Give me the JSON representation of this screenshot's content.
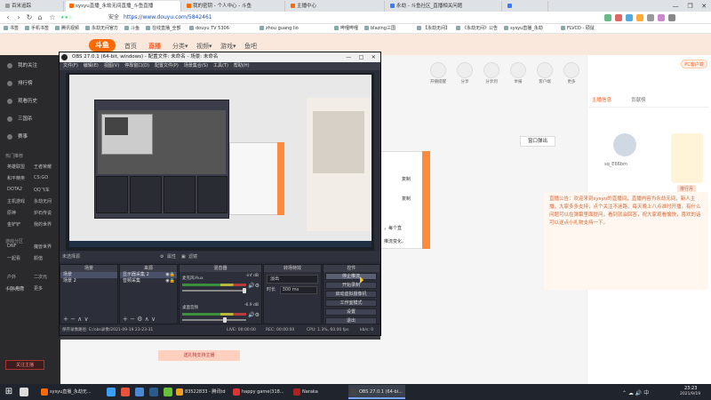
{
  "browser": {
    "tabs": [
      {
        "label": "百米追踪",
        "fav": "#9b9b9b"
      },
      {
        "label": "sysyu直播_永劫无间直播_斗鱼直播",
        "fav": "#ff6a00",
        "active": true
      },
      {
        "label": "我的密钥 - 个人中心 - 斗鱼",
        "fav": "#ff6a00"
      },
      {
        "label": "主播中心",
        "fav": "#ff6a00"
      },
      {
        "label": "永劫 - 斗鱼社区_直播相关问题",
        "fav": "#3b7cff"
      },
      {
        "label": "",
        "fav": "#3b7cff"
      }
    ],
    "window_buttons": [
      "—",
      "❐",
      "✕"
    ],
    "url_secure": "安全",
    "url": "https://www.douyu.com/5842461",
    "bookmarks": [
      "书签",
      "手机书签",
      "腾讯视频",
      "永劫无间官方",
      "斗鱼",
      "在线直播_全部",
      "douyu TV 5306",
      "zhou guang lio",
      "哔哩哔哩",
      "blazing三国",
      "【永劫无间】",
      "《永劫无间》公告",
      "sysyu直播_永劫",
      "FLVCD - 硕鼠"
    ]
  },
  "douyu": {
    "logo": "斗鱼",
    "nav": [
      {
        "label": "首页",
        "on": false
      },
      {
        "label": "直播",
        "on": true
      },
      {
        "label": "分类▾",
        "on": false
      },
      {
        "label": "视频▾",
        "on": false
      },
      {
        "label": "游戏▾",
        "on": false
      },
      {
        "label": "鱼吧",
        "on": false
      }
    ],
    "sidebar": {
      "items": [
        "我的关注",
        "排行榜",
        "观看历史",
        "三国杀",
        "赛事"
      ],
      "sections": [
        "热门推荐",
        "游戏分区",
        "手游休闲"
      ],
      "grid": [
        "英雄联盟",
        "王者荣耀",
        "和平精英",
        "CS:GO",
        "DOTA2",
        "QQ飞车",
        "主机游戏",
        "永劫无间",
        "原神",
        "炉石传说",
        "金铲铲",
        "我的世界",
        "DNF",
        "魔兽世界",
        "一起看",
        "颜值",
        "户外",
        "二次元",
        "LOL电竞",
        "更多"
      ],
      "follow_btn": "关注主播"
    },
    "toolbar": [
      "开播提醒",
      "分享",
      "分享到",
      "举报",
      "客户端",
      "更多"
    ],
    "pc_button": "PC客户端",
    "right_tabs": [
      "主播信息",
      "贡献榜"
    ],
    "popout": "窗口弹出",
    "white_card": [
      "复制",
      "复制",
      "，每个直",
      "推流变化。"
    ],
    "anchor_name": "sq_E66bm",
    "rank_label": "排行月",
    "notice": "直播公告：欢迎来到sysyu的直播间，直播内容为永劫无间，新人主播，大家多多支持，点个关注不迷路，每天晚上八点准时开播，有什么问题可以在弹幕里面提问，看到就会回答，祝大家观看愉快，喜欢的话可以送点小礼物支持一下。",
    "gift_bar": "送礼物支持主播"
  },
  "obs": {
    "title": "OBS 27.0.1 (64-bit, windows) - 配置文件: 未命名 - 场景: 未命名",
    "menu": [
      "文件(F)",
      "编辑(E)",
      "视图(V)",
      "停靠窗口(D)",
      "配置文件(P)",
      "场景集合(S)",
      "工具(T)",
      "帮助(H)"
    ],
    "window_buttons": [
      "—",
      "□",
      "✕"
    ],
    "ctrl_bar": {
      "left": "未选择源",
      "props": "属性",
      "filters": "滤镜"
    },
    "docks": {
      "scenes": {
        "title": "场景",
        "items": [
          "场景",
          "场景 2"
        ]
      },
      "sources": {
        "title": "来源",
        "items": [
          "显示器采集 2",
          "音频采集"
        ]
      },
      "mixer": {
        "title": "混音器",
        "channels": [
          {
            "name": "麦克风/Aux",
            "db": "-inf dB"
          },
          {
            "name": "桌面音频",
            "db": "-6.9 dB"
          }
        ]
      },
      "transitions": {
        "title": "转场特效",
        "type": "淡出",
        "duration_label": "时长",
        "duration": "300 ms"
      },
      "controls": {
        "title": "控件",
        "buttons": [
          "停止推流",
          "开始录制",
          "启动虚拟摄像机",
          "工作室模式",
          "设置",
          "退出"
        ]
      }
    },
    "status": {
      "save": "保存录像路径: E:/obs录像/2021-09-19 23-23-31",
      "live": "LIVE: 00:00:00",
      "rec": "REC: 00:00:00",
      "cpu": "CPU: 1.3%, 60.00 fps",
      "kb": "kb/s: 0"
    },
    "foot_icons": "+ − ∧ ∨",
    "foot_icons_src": "+ − ⚙ ∧ ∨"
  },
  "taskbar": {
    "apps": [
      {
        "label": "sysyu直播_永劫无...",
        "color": "#ff6a00"
      },
      {
        "label": "83522833 - 腾讯td",
        "color": "#f0a020"
      },
      {
        "label": "happy game(318...",
        "color": "#d33"
      },
      {
        "label": "Naraka",
        "color": "#a22"
      },
      {
        "label": "OBS 27.0.1 (64-bi...",
        "color": "#444",
        "active": true
      }
    ],
    "time": "23:23",
    "date": "2021/9/19"
  },
  "colors": {
    "accent": "#ff5d23",
    "obs_bg": "#2b2e38"
  }
}
